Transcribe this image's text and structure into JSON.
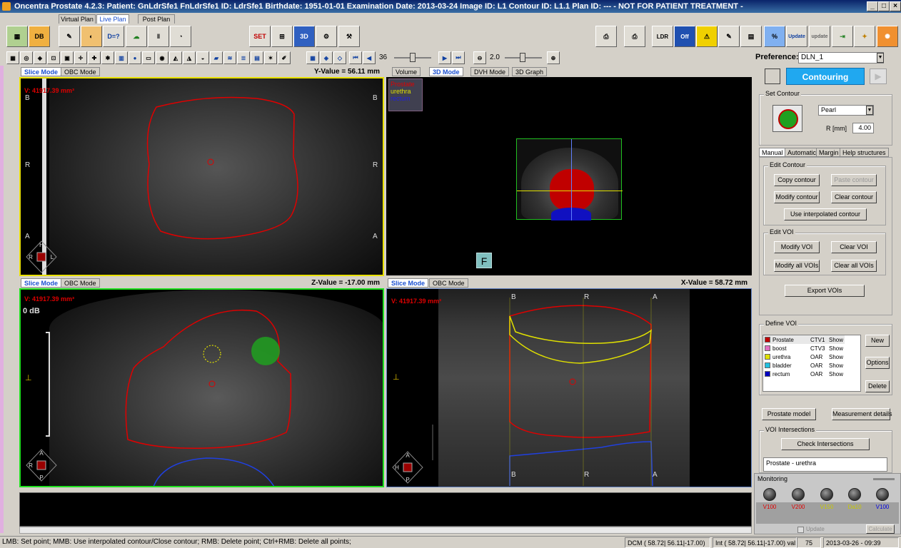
{
  "window": {
    "title": "Oncentra Prostate 4.2.3:   Patient: GnLdrSfe1 FnLdrSfe1   ID: LdrSfe1   Birthdate: 1951-01-01   Examination Date: 2013-03-24   Image ID: L1   Contour ID: L1.1   Plan ID: ---   - NOT FOR PATIENT TREATMENT -"
  },
  "plan_tabs": [
    "Virtual Plan",
    "Live Plan",
    "Post Plan"
  ],
  "toolbar": {
    "db_label": "DB",
    "dose_label": "D=?",
    "set_label": "SET",
    "view3d_label": "3D",
    "ldr_label": "LDR",
    "off_label": "Off",
    "update_label": "Update",
    "update2_label": "update",
    "slice_number": "36",
    "zoom_value": "2.0"
  },
  "viewports": {
    "top_left": {
      "mode_tabs": [
        "Slice Mode",
        "OBC Mode"
      ],
      "value": "Y-Value = 56.11 mm",
      "volume": "V: 41917.39 mm³"
    },
    "top_right": {
      "mode_tabs": [
        "Volume",
        "3D Mode",
        "DVH Mode",
        "3D Graph"
      ],
      "legend": [
        "Prostate",
        "urethra",
        "rectum"
      ],
      "face_label": "F"
    },
    "bottom_left": {
      "mode_tabs": [
        "Slice Mode",
        "OBC Mode"
      ],
      "value": "Z-Value = -17.00 mm",
      "volume": "V: 41917.39 mm³",
      "gain": "0 dB"
    },
    "bottom_right": {
      "mode_tabs": [
        "Slice Mode",
        "OBC Mode"
      ],
      "value": "X-Value = 58.72 mm",
      "volume": "V: 41917.39 mm³"
    }
  },
  "orient": {
    "B": "B",
    "R": "R",
    "A": "A",
    "H": "H",
    "L": "L",
    "F": "F",
    "P": "P"
  },
  "right_panel": {
    "preference_label": "Preference:",
    "preference_value": "DLN_1",
    "mode_button": "Contouring",
    "set_contour_title": "Set Contour",
    "pen_type": "Pearl",
    "radius_label": "R [mm]",
    "radius_value": "4.00",
    "tabs": [
      "Manual",
      "Automatic",
      "Margin",
      "Help structures"
    ],
    "edit_contour_title": "Edit Contour",
    "copy_contour": "Copy contour",
    "paste_contour": "Paste contour",
    "modify_contour": "Modify contour",
    "clear_contour": "Clear contour",
    "use_interpolated": "Use interpolated contour",
    "edit_voi_title": "Edit VOI",
    "modify_voi": "Modify VOI",
    "clear_voi": "Clear VOI",
    "modify_all_vois": "Modify all VOIs",
    "clear_all_vois": "Clear all VOIs",
    "export_vois": "Export VOIs",
    "define_voi_title": "Define VOI",
    "voi_rows": [
      {
        "name": "Prostate",
        "type": "CTV1",
        "show": "Show",
        "color": "#c00000"
      },
      {
        "name": "boost",
        "type": "CTV3",
        "show": "Show",
        "color": "#e070c0"
      },
      {
        "name": "urethra",
        "type": "OAR",
        "show": "Show",
        "color": "#e0e000"
      },
      {
        "name": "bladder",
        "type": "OAR",
        "show": "Show",
        "color": "#20c0e0"
      },
      {
        "name": "rectum",
        "type": "OAR",
        "show": "Show",
        "color": "#0000c0"
      }
    ],
    "new_btn": "New",
    "options_btn": "Options",
    "delete_btn": "Delete",
    "prostate_model": "Prostate model",
    "measurement_details": "Measurement details",
    "voi_intersections_title": "VOI Intersections",
    "check_intersections": "Check Intersections",
    "intersection_item": "Prostate - urethra",
    "monitoring_title": "Monitoring",
    "monitors": [
      {
        "label": "V100",
        "color": "#e00000"
      },
      {
        "label": "V200",
        "color": "#e00000"
      },
      {
        "label": "V150",
        "color": "#c8c800"
      },
      {
        "label": "Da10",
        "color": "#c8c800"
      },
      {
        "label": "V100",
        "color": "#0000e0"
      }
    ],
    "update_check": "Update",
    "calculate_btn": "Calculate"
  },
  "statusbar": {
    "hint": "LMB: Set point; MMB: Use interpolated contour/Close contour; RMB: Delete point; Ctrl+RMB: Delete all points;",
    "dcm": "DCM ( 58.72| 56.11|-17.00)",
    "int": "Int ( 58.72| 56.11|-17.00) val:",
    "val": "75",
    "datetime": "2013-03-26 - 09:39"
  }
}
